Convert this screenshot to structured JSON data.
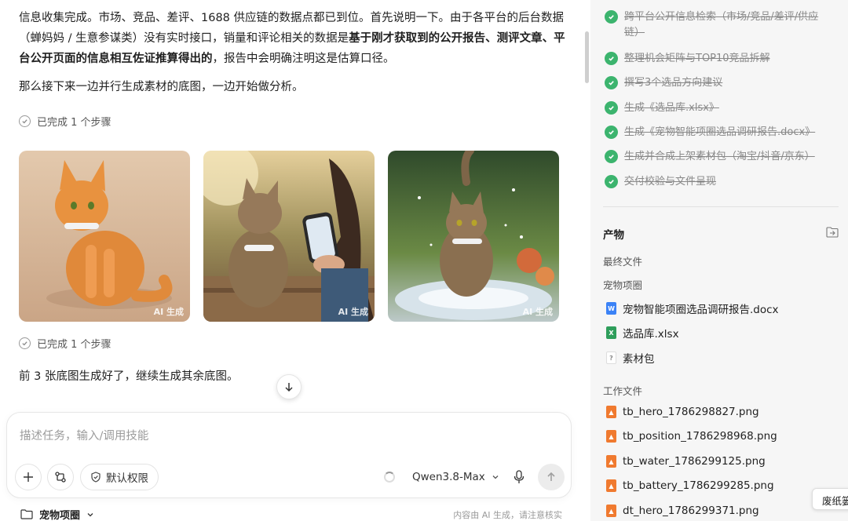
{
  "chat": {
    "para1_a": "信息收集完成。市场、竞品、差评、1688 供应链的数据点都已到位。首先说明一下。由于各平台的后台数据（蝉妈妈 / 生意参谋类）没有实时接口，销量和评论相关的数据是",
    "para1_bold": "基于刚才获取到的公开报告、测评文章、平台公开页面的信息相互佐证推算得出的",
    "para1_b": "，报告中会明确注明这是估算口径。",
    "para2": "那么接下来一边并行生成素材的底图，一边开始做分析。",
    "step1": "已完成 1 个步骤",
    "step2": "已完成 1 个步骤",
    "ai_label_1": "AI 生成",
    "ai_label_2": "AI 生成",
    "ai_label_3": "AI 生成",
    "para3": "前 3 张底图生成好了，继续生成其余底图。"
  },
  "composer": {
    "placeholder": "描述任务，输入/调用技能",
    "permission": "默认权限",
    "model": "Qwen3.8-Max"
  },
  "footer": {
    "project": "宠物项圈",
    "disclaimer": "内容由 AI 生成，请注意核实"
  },
  "tasks": [
    "跨平台公开信息检索（市场/竞品/差评/供应链）",
    "整理机会矩阵与TOP10竞品拆解",
    "撰写3个选品方向建议",
    "生成《选品库.xlsx》",
    "生成《宠物智能项圈选品调研报告.docx》",
    "生成并合成上架素材包（淘宝/抖音/京东）",
    "交付校验与文件呈现"
  ],
  "outputs": {
    "title": "产物",
    "final_label": "最终文件",
    "folder": "宠物项圈",
    "final_files": [
      {
        "name": "宠物智能项圈选品调研报告.docx",
        "type": "docx"
      },
      {
        "name": "选品库.xlsx",
        "type": "xlsx"
      },
      {
        "name": "素材包",
        "type": "unknown"
      }
    ],
    "work_label": "工作文件",
    "work_files": [
      "tb_hero_1786298827.png",
      "tb_position_1786298968.png",
      "tb_water_1786299125.png",
      "tb_battery_1786299285.png",
      "dt_hero_1786299371.png"
    ],
    "tooltip": "废纸篓"
  },
  "colors": {
    "accent_green": "#3cb46e",
    "docx_blue": "#3b82f6",
    "xlsx_green": "#2e9e5b",
    "png_orange": "#f07a2f"
  }
}
